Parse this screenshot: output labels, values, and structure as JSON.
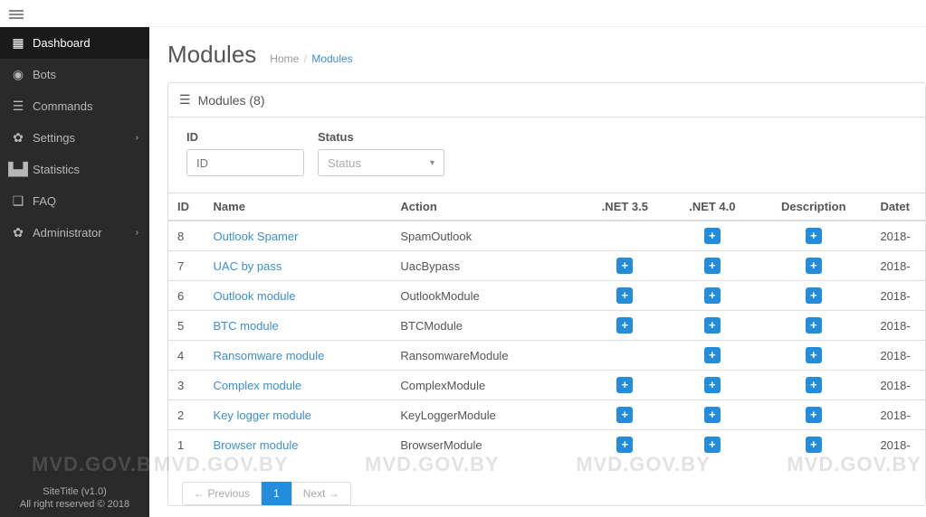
{
  "sidebar": {
    "items": [
      {
        "label": "Dashboard",
        "icon": "dashboard",
        "active": true
      },
      {
        "label": "Bots",
        "icon": "bot",
        "active": false
      },
      {
        "label": "Commands",
        "icon": "list",
        "active": false
      },
      {
        "label": "Settings",
        "icon": "gear",
        "active": false,
        "expandable": true
      },
      {
        "label": "Statistics",
        "icon": "chart",
        "active": false
      },
      {
        "label": "FAQ",
        "icon": "faq",
        "active": false
      },
      {
        "label": "Administrator",
        "icon": "gear",
        "active": false,
        "expandable": true
      }
    ],
    "footer": {
      "line1": "SiteTitle (v1.0)",
      "line2": "All right reserved © 2018"
    }
  },
  "page": {
    "title": "Modules",
    "breadcrumb": {
      "home": "Home",
      "sep": "/",
      "current": "Modules"
    }
  },
  "panel": {
    "title": "Modules (8)"
  },
  "filters": {
    "id": {
      "label": "ID",
      "placeholder": "ID"
    },
    "status": {
      "label": "Status",
      "placeholder": "Status"
    }
  },
  "table": {
    "headers": {
      "id": "ID",
      "name": "Name",
      "action": "Action",
      "net35": ".NET 3.5",
      "net40": ".NET 4.0",
      "desc": "Description",
      "date": "Datet"
    },
    "rows": [
      {
        "id": "8",
        "name": "Outlook Spamer",
        "action": "SpamOutlook",
        "net35": false,
        "net40": true,
        "desc": true,
        "date": "2018-"
      },
      {
        "id": "7",
        "name": "UAC by pass",
        "action": "UacBypass",
        "net35": true,
        "net40": true,
        "desc": true,
        "date": "2018-"
      },
      {
        "id": "6",
        "name": "Outlook module",
        "action": "OutlookModule",
        "net35": true,
        "net40": true,
        "desc": true,
        "date": "2018-"
      },
      {
        "id": "5",
        "name": "BTC module",
        "action": "BTCModule",
        "net35": true,
        "net40": true,
        "desc": true,
        "date": "2018-"
      },
      {
        "id": "4",
        "name": "Ransomware module",
        "action": "RansomwareModule",
        "net35": false,
        "net40": true,
        "desc": true,
        "date": "2018-"
      },
      {
        "id": "3",
        "name": "Complex module",
        "action": "ComplexModule",
        "net35": true,
        "net40": true,
        "desc": true,
        "date": "2018-"
      },
      {
        "id": "2",
        "name": "Key logger module",
        "action": "KeyLoggerModule",
        "net35": true,
        "net40": true,
        "desc": true,
        "date": "2018-"
      },
      {
        "id": "1",
        "name": "Browser module",
        "action": "BrowserModule",
        "net35": true,
        "net40": true,
        "desc": true,
        "date": "2018-"
      }
    ]
  },
  "pagination": {
    "prev": "← Previous",
    "page1": "1",
    "next": "Next →"
  },
  "watermark": "MVD.GOV.BY",
  "icons": {
    "dashboard": "▦",
    "bot": "◉",
    "list": "☰",
    "gear": "✿",
    "chart": "▙▟",
    "faq": "❑",
    "plus": "+"
  }
}
